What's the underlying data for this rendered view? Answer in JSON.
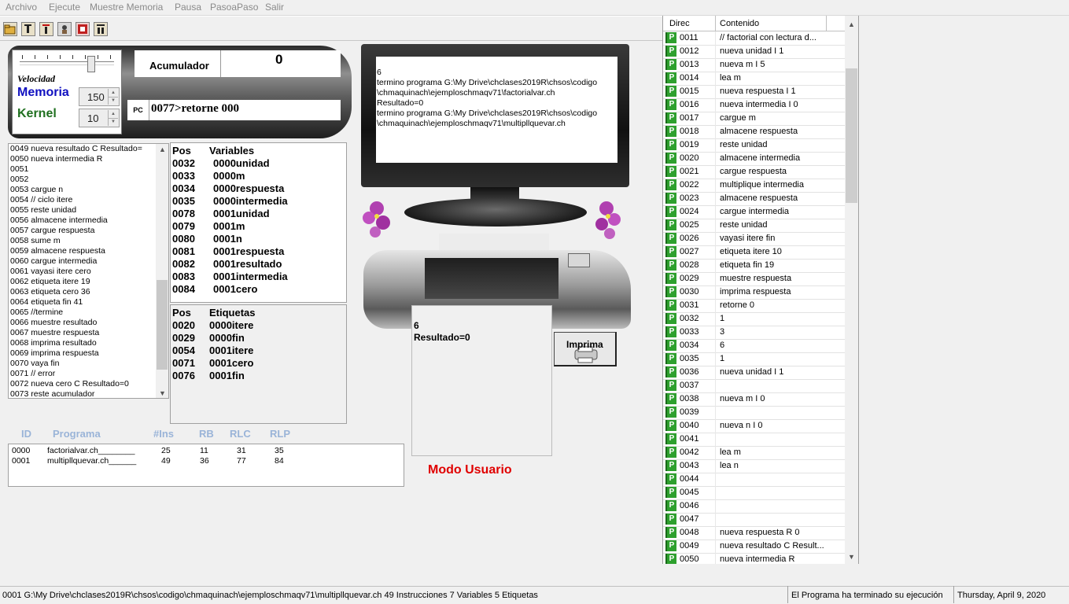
{
  "menu": [
    "Archivo",
    "Ejecute",
    "Muestre Memoria",
    "Pausa",
    "PasoaPaso",
    "Salir"
  ],
  "toolbar": {
    "icons": [
      "open-folder-icon",
      "step-icon",
      "step-into-icon",
      "run-icon",
      "memory-icon",
      "pause-icon"
    ]
  },
  "controls": {
    "velocidad_label": "Velocidad",
    "speed_level": 0.8,
    "memoria_label": "Memoria",
    "memoria_value": "150",
    "kernel_label": "Kernel",
    "kernel_value": "10",
    "acumulador_label": "Acumulador",
    "acumulador_value": "0",
    "pc_label": "PC",
    "pc_value": "0077>retorne 000"
  },
  "listing": [
    "0049 nueva resultado C Resultado=",
    "0050 nueva intermedia R",
    "0051",
    "0052",
    "0053 cargue n",
    "0054 // ciclo itere",
    "0055 reste unidad",
    "0056 almacene intermedia",
    "0057 cargue respuesta",
    "0058 sume m",
    "0059 almacene respuesta",
    "0060 cargue intermedia",
    "0061 vayasi itere cero",
    "0062 etiqueta itere 19",
    "0063 etiqueta cero 36",
    "0064 etiqueta fin 41",
    "0065 //termine",
    "0066 muestre resultado",
    "0067 muestre respuesta",
    "0068 imprima resultado",
    "0069 imprima respuesta",
    "0070 vaya fin",
    "0071 // error",
    "0072 nueva cero C Resultado=0",
    "0073 reste acumulador"
  ],
  "variables": {
    "header_pos": "Pos",
    "header_name": "Variables",
    "rows": [
      {
        "pos": "0032",
        "val": "0000unidad"
      },
      {
        "pos": "0033",
        "val": "0000m"
      },
      {
        "pos": "0034",
        "val": "0000respuesta"
      },
      {
        "pos": "0035",
        "val": "0000intermedia"
      },
      {
        "pos": "0078",
        "val": "0001unidad"
      },
      {
        "pos": "0079",
        "val": "0001m"
      },
      {
        "pos": "0080",
        "val": "0001n"
      },
      {
        "pos": "0081",
        "val": "0001respuesta"
      },
      {
        "pos": "0082",
        "val": "0001resultado"
      },
      {
        "pos": "0083",
        "val": "0001intermedia"
      },
      {
        "pos": "0084",
        "val": "0001cero"
      }
    ]
  },
  "etiquetas": {
    "header_pos": "Pos",
    "header_name": "Etiquetas",
    "rows": [
      {
        "pos": "0020",
        "val": "0000itere"
      },
      {
        "pos": "0029",
        "val": "0000fin"
      },
      {
        "pos": "0054",
        "val": "0001itere"
      },
      {
        "pos": "0071",
        "val": "0001cero"
      },
      {
        "pos": "0076",
        "val": "0001fin"
      }
    ]
  },
  "monitor": [
    "6",
    "termino programa G:\\My Drive\\chclases2019R\\chsos\\codigo",
    "\\chmaquinach\\ejemploschmaqv71\\factorialvar.ch",
    "Resultado=0",
    "termino programa G:\\My Drive\\chclases2019R\\chsos\\codigo",
    "\\chmaquinach\\ejemploschmaqv71\\multipllquevar.ch"
  ],
  "printer": {
    "lines": [
      "6",
      "Resultado=0"
    ],
    "button_label": "Imprima"
  },
  "modo": "Modo Usuario",
  "processes": {
    "headers": [
      "ID",
      "Programa",
      "#Ins",
      "RB",
      "RLC",
      "RLP"
    ],
    "rows": [
      [
        "0000",
        "factorialvar.ch________",
        "25",
        "11",
        "31",
        "35"
      ],
      [
        "0001",
        "multipllquevar.ch______",
        "49",
        "36",
        "77",
        "84"
      ]
    ]
  },
  "memory": {
    "headers": [
      "Direc",
      "Contenido"
    ],
    "rows": [
      {
        "dir": "0011",
        "val": "// factorial con lectura d..."
      },
      {
        "dir": "0012",
        "val": "nueva unidad I 1"
      },
      {
        "dir": "0013",
        "val": "nueva m I 5"
      },
      {
        "dir": "0014",
        "val": "lea m"
      },
      {
        "dir": "0015",
        "val": "nueva respuesta I 1"
      },
      {
        "dir": "0016",
        "val": "nueva intermedia I 0"
      },
      {
        "dir": "0017",
        "val": "cargue m"
      },
      {
        "dir": "0018",
        "val": "almacene respuesta"
      },
      {
        "dir": "0019",
        "val": "reste unidad"
      },
      {
        "dir": "0020",
        "val": "almacene intermedia"
      },
      {
        "dir": "0021",
        "val": "cargue respuesta"
      },
      {
        "dir": "0022",
        "val": "multiplique intermedia"
      },
      {
        "dir": "0023",
        "val": "almacene respuesta"
      },
      {
        "dir": "0024",
        "val": "cargue intermedia"
      },
      {
        "dir": "0025",
        "val": "reste unidad"
      },
      {
        "dir": "0026",
        "val": "vayasi itere fin"
      },
      {
        "dir": "0027",
        "val": "etiqueta itere 10"
      },
      {
        "dir": "0028",
        "val": "etiqueta fin 19"
      },
      {
        "dir": "0029",
        "val": "muestre respuesta"
      },
      {
        "dir": "0030",
        "val": "imprima respuesta"
      },
      {
        "dir": "0031",
        "val": "retorne 0"
      },
      {
        "dir": "0032",
        "val": "1"
      },
      {
        "dir": "0033",
        "val": "3"
      },
      {
        "dir": "0034",
        "val": "6"
      },
      {
        "dir": "0035",
        "val": "1"
      },
      {
        "dir": "0036",
        "val": "nueva unidad I 1"
      },
      {
        "dir": "0037",
        "val": ""
      },
      {
        "dir": "0038",
        "val": "nueva m I 0"
      },
      {
        "dir": "0039",
        "val": ""
      },
      {
        "dir": "0040",
        "val": "nueva n I 0"
      },
      {
        "dir": "0041",
        "val": ""
      },
      {
        "dir": "0042",
        "val": "lea m"
      },
      {
        "dir": "0043",
        "val": "lea n"
      },
      {
        "dir": "0044",
        "val": ""
      },
      {
        "dir": "0045",
        "val": ""
      },
      {
        "dir": "0046",
        "val": ""
      },
      {
        "dir": "0047",
        "val": ""
      },
      {
        "dir": "0048",
        "val": "nueva respuesta R 0"
      },
      {
        "dir": "0049",
        "val": "nueva resultado C Result..."
      },
      {
        "dir": "0050",
        "val": "nueva intermedia R"
      }
    ]
  },
  "status": {
    "file": "0001  G:\\My Drive\\chclases2019R\\chsos\\codigo\\chmaquinach\\ejemploschmaqv71\\multipllquevar.ch    49 Instrucciones  7 Variables 5 Etiquetas",
    "message": "El Programa ha terminado su ejecución",
    "date": "Thursday, April 9, 2020"
  }
}
